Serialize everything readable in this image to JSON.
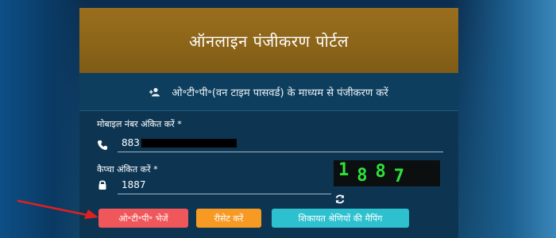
{
  "banner": {
    "title": "ऑनलाइन पंजीकरण पोर्टल"
  },
  "subheader": {
    "text": "ओ॰टी॰पी॰(वन टाइम पासवर्ड) के माध्यम से पंजीकरण करें",
    "icon": "user-add-icon"
  },
  "mobile": {
    "label": "मोबाइल नंबर अंकित करें *",
    "value_prefix": "883",
    "icon": "phone-icon"
  },
  "captcha_field": {
    "label": "कैप्चा अंकित करें *",
    "value": "1887",
    "icon": "lock-icon"
  },
  "captcha_image": {
    "digits": [
      "1",
      "8",
      "8",
      "7"
    ],
    "refresh_icon": "refresh-icon"
  },
  "buttons": {
    "send_otp": "ओ॰टी॰पी॰ भेजें",
    "reset": "रीसेट करें",
    "complaint_mapping": "शिकायत श्रेणियों की मैपिंग"
  },
  "colors": {
    "banner": "#8b6418",
    "send_otp": "#f0575b",
    "reset": "#f69a24",
    "complaint_mapping": "#2dc1cf",
    "captcha_text": "#2de23b",
    "annotation_arrow": "#e02020"
  }
}
